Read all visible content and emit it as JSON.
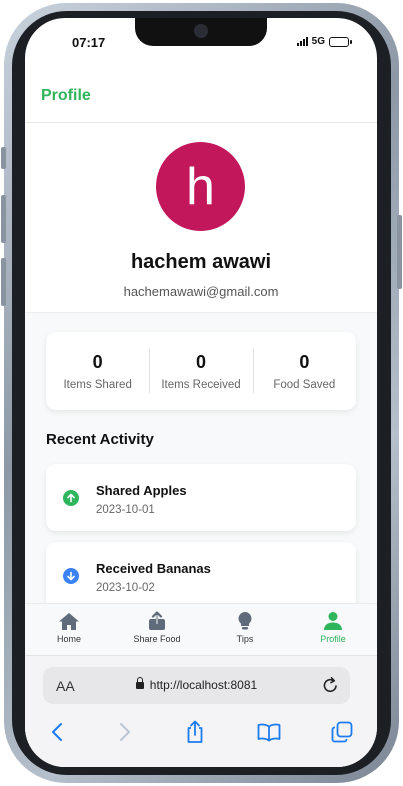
{
  "status": {
    "time": "07:17",
    "network": "5G"
  },
  "header": {
    "title": "Profile"
  },
  "profile": {
    "initial": "h",
    "name": "hachem awawi",
    "email": "hachemawawi@gmail.com",
    "avatar_color": "#c2185b"
  },
  "stats": [
    {
      "value": "0",
      "label": "Items Shared"
    },
    {
      "value": "0",
      "label": "Items Received"
    },
    {
      "value": "0",
      "label": "Food Saved"
    }
  ],
  "recent": {
    "title": "Recent Activity",
    "items": [
      {
        "title": "Shared Apples",
        "date": "2023-10-01",
        "icon": "arrow-up-circle-icon",
        "color": "#2fb55b"
      },
      {
        "title": "Received Bananas",
        "date": "2023-10-02",
        "icon": "arrow-down-circle-icon",
        "color": "#3b82f6"
      }
    ]
  },
  "tabs": [
    {
      "label": "Home",
      "icon": "home-icon"
    },
    {
      "label": "Share Food",
      "icon": "share-icon"
    },
    {
      "label": "Tips",
      "icon": "lightbulb-icon"
    },
    {
      "label": "Profile",
      "icon": "person-icon",
      "active": true
    }
  ],
  "browser": {
    "aa": "AA",
    "url": "http://localhost:8081"
  },
  "colors": {
    "accent": "#2fb55b",
    "ios_blue": "#1a7cf0"
  }
}
